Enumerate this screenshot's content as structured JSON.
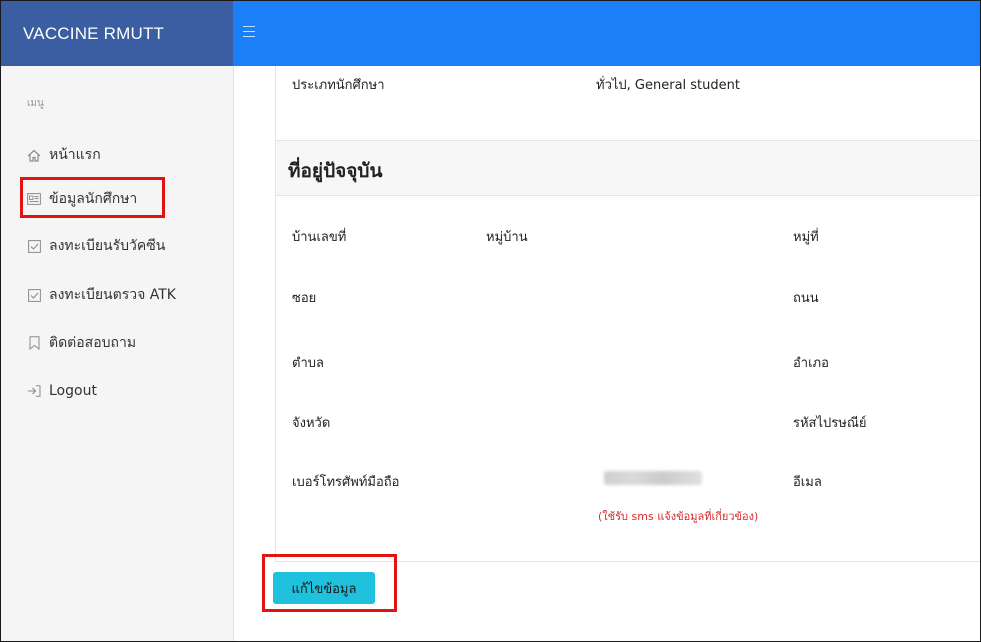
{
  "brand": "VACCINE RMUTT",
  "sidebar": {
    "header": "เมนู",
    "items": [
      {
        "label": "หน้าแรก",
        "icon": "home-icon"
      },
      {
        "label": "ข้อมูลนักศึกษา",
        "icon": "id-card-icon"
      },
      {
        "label": "ลงทะเบียนรับวัคซีน",
        "icon": "checkbox-icon"
      },
      {
        "label": "ลงทะเบียนตรวจ ATK",
        "icon": "checkbox-icon"
      },
      {
        "label": "ติดต่อสอบถาม",
        "icon": "bookmark-icon"
      },
      {
        "label": "Logout",
        "icon": "sign-in-icon"
      }
    ]
  },
  "student": {
    "type_label": "ประเภทนักศึกษา",
    "type_value": "ทั่วไป, General student"
  },
  "address": {
    "section_title": "ที่อยู่ปัจจุบัน",
    "house_no_label": "บ้านเลขที่",
    "village_label": "หมู่บ้าน",
    "moo_label": "หมู่ที่",
    "soi_label": "ซอย",
    "road_label": "ถนน",
    "subdistrict_label": "ตำบล",
    "district_label": "อำเภอ",
    "province_label": "จังหวัด",
    "postcode_label": "รหัสไปรษณีย์",
    "phone_label": "เบอร์โทรศัพท์มือถือ",
    "email_label": "อีเมล",
    "phone_note": "(ใช้รับ sms แจ้งข้อมูลที่เกี่ยวข้อง)"
  },
  "actions": {
    "edit_label": "แก้ไขข้อมูล"
  },
  "colors": {
    "topbar": "#1b7ff8",
    "brand_bg": "#3a5ea1",
    "highlight": "#e11414",
    "button": "#1fc1dd",
    "note": "#d92a2a"
  }
}
